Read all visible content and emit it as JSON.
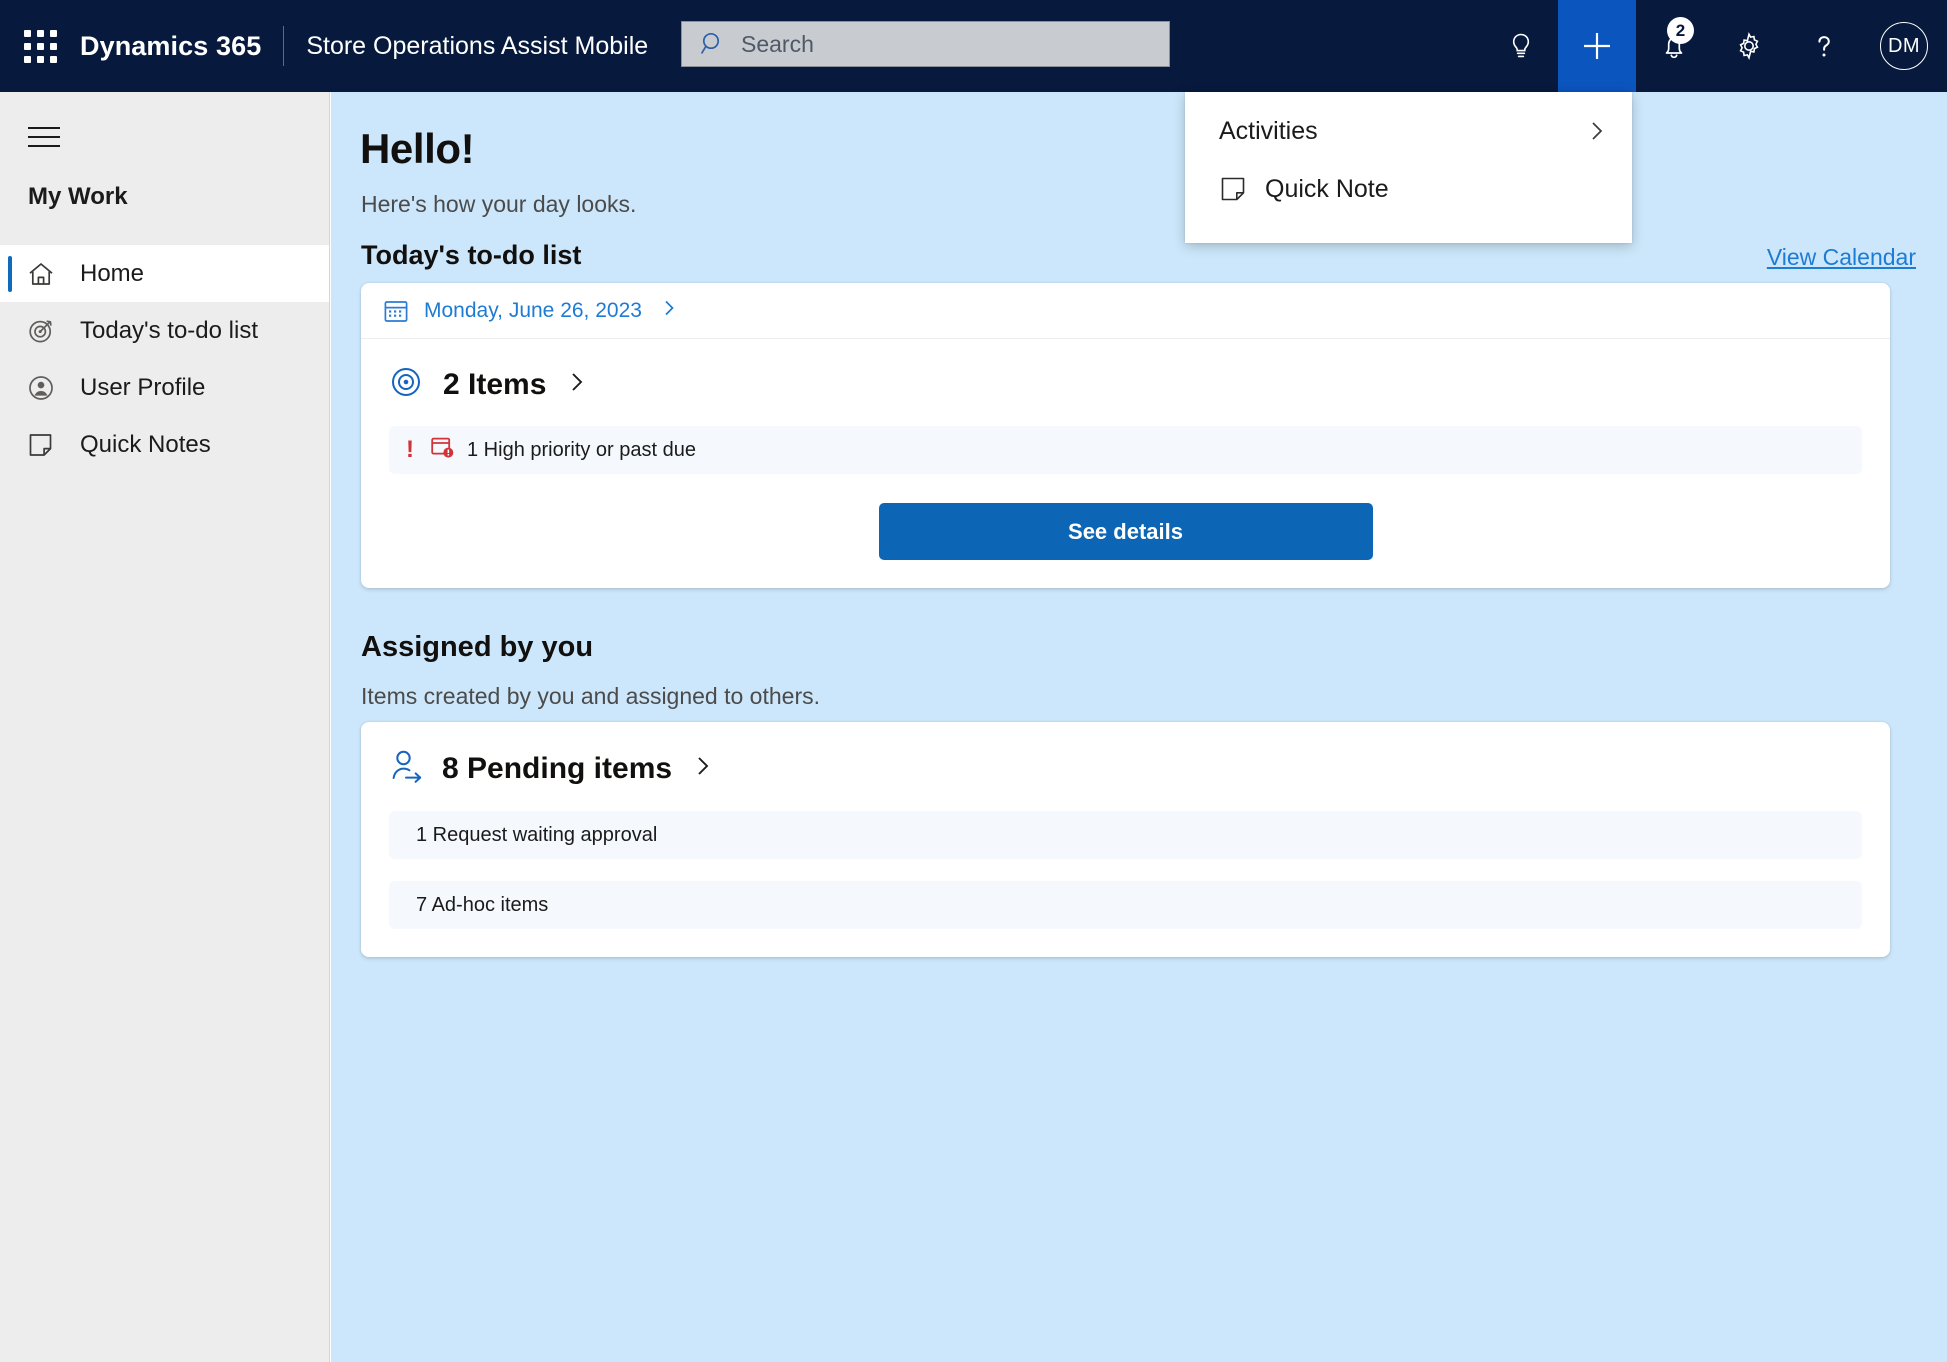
{
  "topbar": {
    "waffle_label": "app-launcher",
    "brand": "Dynamics 365",
    "app_name": "Store Operations Assist Mobile",
    "search_placeholder": "Search",
    "notification_count": "2",
    "avatar_initials": "DM",
    "accent_blue": "#0B55BF",
    "bar_bg": "#071A3D"
  },
  "flyout": {
    "items": [
      {
        "label": "Activities",
        "has_submenu": true,
        "icon": ""
      },
      {
        "label": "Quick Note",
        "has_submenu": false,
        "icon": "note-icon"
      }
    ]
  },
  "sidebar": {
    "group_title": "My Work",
    "items": [
      {
        "label": "Home",
        "icon": "home-icon",
        "active": true
      },
      {
        "label": "Today's to-do list",
        "icon": "target-icon",
        "active": false
      },
      {
        "label": "User Profile",
        "icon": "user-circle-icon",
        "active": false
      },
      {
        "label": "Quick Notes",
        "icon": "note-icon",
        "active": false
      }
    ]
  },
  "main": {
    "greeting": "Hello!",
    "subgreeting": "Here's how your day looks.",
    "todo": {
      "title": "Today's to-do list",
      "view_calendar": "View Calendar",
      "date": "Monday, June 26, 2023",
      "items_count": "2 Items",
      "alert": "1 High priority or past due",
      "cta": "See details"
    },
    "assigned": {
      "title": "Assigned by you",
      "subtitle": "Items created by you and assigned to others.",
      "pending_count": "8 Pending items",
      "rows": [
        "1 Request waiting approval",
        "7 Ad-hoc items"
      ]
    }
  },
  "colors": {
    "canvas": "#CCE7FB",
    "card": "#FFFFFF",
    "tile": "#F5F8FC",
    "link": "#1E7BD4",
    "primary_button": "#0C66B5",
    "danger": "#D13438",
    "sidebar": "#EDEDED"
  }
}
